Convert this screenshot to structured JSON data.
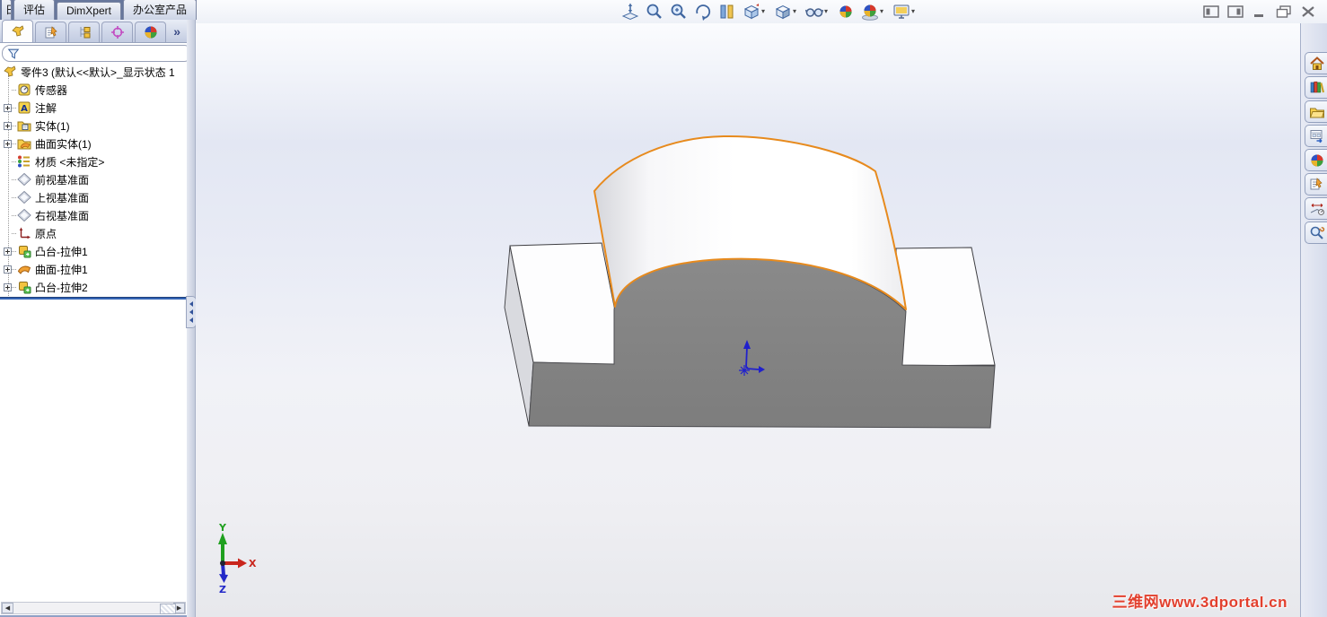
{
  "command_tabs": {
    "leading_fragment": "日",
    "tabs": [
      {
        "label": "评估"
      },
      {
        "label": "DimXpert"
      },
      {
        "label": "办公室产品"
      }
    ]
  },
  "manager_tabs": {
    "tabs": [
      {
        "icon": "featuremanager",
        "active": true
      },
      {
        "icon": "propertymanager",
        "active": false
      },
      {
        "icon": "configurationmanager",
        "active": false
      },
      {
        "icon": "dimxpertmanager",
        "active": false
      },
      {
        "icon": "displaymanager",
        "active": false
      }
    ],
    "overflow_label": "»"
  },
  "filter": {
    "icon": "filter-funnel"
  },
  "feature_tree": {
    "rows": [
      {
        "icon": "part",
        "label": "零件3 (默认<<默认>_显示状态 1",
        "level": 0,
        "expandable": false
      },
      {
        "icon": "sensors",
        "label": "传感器",
        "level": 1,
        "expandable": false
      },
      {
        "icon": "annotations",
        "label": "注解",
        "level": 1,
        "expandable": true
      },
      {
        "icon": "solid-bodies",
        "label": "实体(1)",
        "level": 1,
        "expandable": true
      },
      {
        "icon": "surface-bodies",
        "label": "曲面实体(1)",
        "level": 1,
        "expandable": true
      },
      {
        "icon": "material",
        "label": "材质 <未指定>",
        "level": 1,
        "expandable": false
      },
      {
        "icon": "plane",
        "label": "前视基准面",
        "level": 1,
        "expandable": false
      },
      {
        "icon": "plane",
        "label": "上视基准面",
        "level": 1,
        "expandable": false
      },
      {
        "icon": "plane",
        "label": "右视基准面",
        "level": 1,
        "expandable": false
      },
      {
        "icon": "origin",
        "label": "原点",
        "level": 1,
        "expandable": false
      },
      {
        "icon": "boss-extrude",
        "label": "凸台-拉伸1",
        "level": 1,
        "expandable": true
      },
      {
        "icon": "surface-extrude",
        "label": "曲面-拉伸1",
        "level": 1,
        "expandable": true
      },
      {
        "icon": "boss-extrude",
        "label": "凸台-拉伸2",
        "level": 1,
        "expandable": true
      }
    ]
  },
  "heads_up_toolbar": {
    "buttons": [
      {
        "icon": "zoom-to-fit",
        "dropdown": false
      },
      {
        "icon": "zoom-to-area",
        "dropdown": false
      },
      {
        "icon": "zoom-in-out",
        "dropdown": false
      },
      {
        "icon": "rotate-view",
        "dropdown": false
      },
      {
        "icon": "section-view",
        "dropdown": false
      },
      {
        "icon": "view-orientation",
        "dropdown": true
      },
      {
        "icon": "display-style",
        "dropdown": true
      },
      {
        "icon": "hide-show-items",
        "dropdown": true
      },
      {
        "icon": "edit-appearance",
        "dropdown": false
      },
      {
        "icon": "apply-scene",
        "dropdown": true
      },
      {
        "icon": "view-settings",
        "dropdown": true
      }
    ]
  },
  "window_controls": {
    "buttons": [
      {
        "icon": "pane-left"
      },
      {
        "icon": "pane-right"
      },
      {
        "icon": "minimize"
      },
      {
        "icon": "restore"
      },
      {
        "icon": "close"
      }
    ]
  },
  "task_pane": {
    "tabs": [
      {
        "icon": "resources-home"
      },
      {
        "icon": "design-library"
      },
      {
        "icon": "file-explorer"
      },
      {
        "icon": "view-palette"
      },
      {
        "icon": "appearances"
      },
      {
        "icon": "custom-properties"
      },
      {
        "icon": "dimension-tools"
      },
      {
        "icon": "search-tools"
      }
    ]
  },
  "viewport": {
    "watermark": "三维网www.3dportal.cn",
    "triad": {
      "x_label": "X",
      "y_label": "Y",
      "z_label": "Z"
    },
    "colors": {
      "model_gray": "#7d7d7d",
      "model_gray_light": "#8a8a8a",
      "surface_edge_orange": "#e78a1d",
      "face_white": "#fdfdfe",
      "side_gray": "#d9dadf",
      "edge_dark": "#3e3e42",
      "origin_triad_blue": "#2020cc",
      "triad_x_red": "#c9251c",
      "triad_y_green": "#1fa01f",
      "triad_z_blue": "#2329c8"
    }
  }
}
